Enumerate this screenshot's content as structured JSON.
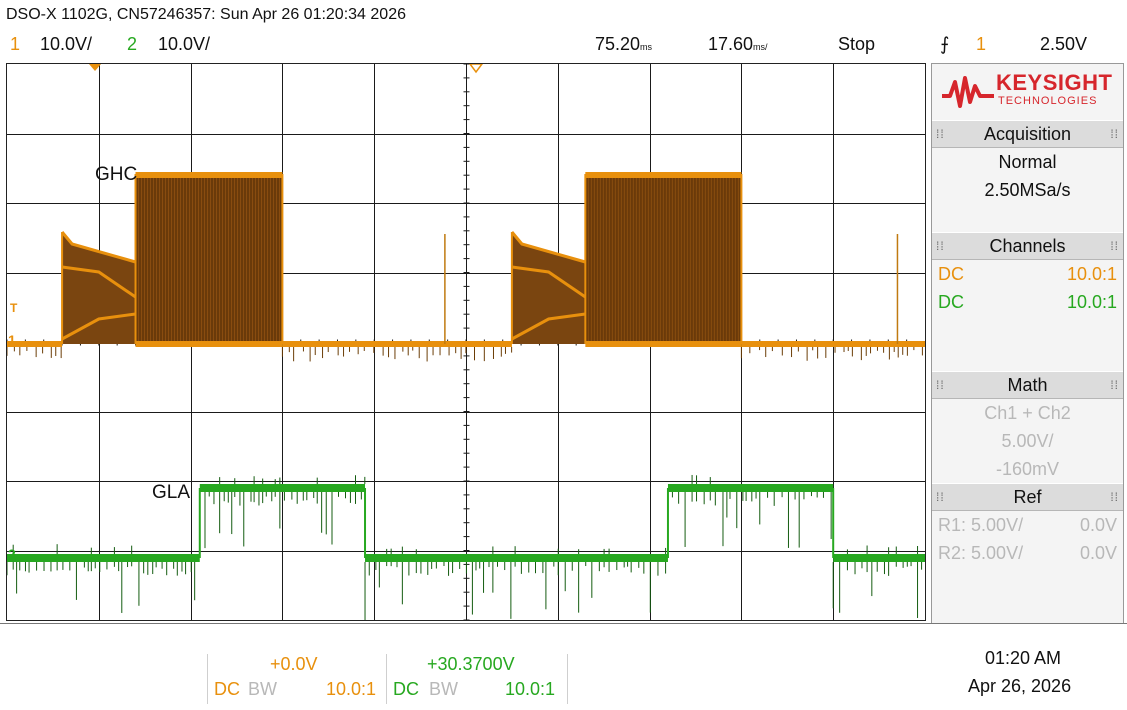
{
  "header": {
    "title": "DSO-X 1102G, CN57246357: Sun Apr 26 01:20:34 2026",
    "ch1_number": "1",
    "ch1_scale": "10.0V/",
    "ch2_number": "2",
    "ch2_scale": "10.0V/",
    "time_delay": "75.20",
    "time_delay_unit": "ms",
    "time_scale": "17.60",
    "time_scale_unit": "ms/",
    "run_state": "Stop",
    "trigger_edge": "⨍",
    "trigger_source": "1",
    "trigger_level": "2.50V"
  },
  "display": {
    "trace1_label": "GHC",
    "trace2_label": "GLA",
    "ch1_marker": "1",
    "ch2_marker": "2",
    "trigger_marker": "T"
  },
  "panel": {
    "brand_name": "KEYSIGHT",
    "brand_sub": "TECHNOLOGIES",
    "acquisition": {
      "title": "Acquisition",
      "mode": "Normal",
      "rate": "2.50MSa/s"
    },
    "channels": {
      "title": "Channels",
      "rows": [
        {
          "coupling": "DC",
          "probe": "10.0:1",
          "color": "#e8900d"
        },
        {
          "coupling": "DC",
          "probe": "10.0:1",
          "color": "#27a820"
        }
      ]
    },
    "math": {
      "title": "Math",
      "expr": "Ch1 + Ch2",
      "scale": "5.00V/",
      "offset": "-160mV"
    },
    "ref": {
      "title": "Ref",
      "rows": [
        {
          "name": "R1:",
          "scale": "5.00V/",
          "offset": "0.0V"
        },
        {
          "name": "R2:",
          "scale": "5.00V/",
          "offset": "0.0V"
        }
      ]
    }
  },
  "bottom": {
    "ch1": {
      "offset": "+0.0V",
      "coupling": "DC",
      "bw": "BW",
      "probe": "10.0:1"
    },
    "ch2": {
      "offset": "+30.3700V",
      "coupling": "DC",
      "bw": "BW",
      "probe": "10.0:1"
    },
    "time": "01:20 AM",
    "date": "Apr 26, 2026"
  },
  "colors": {
    "ch1": "#e8900d",
    "ch2": "#27a820",
    "grid": "#111111",
    "brand": "#d6262c"
  },
  "signals": {
    "ghc_segments": [
      {
        "from": 0.0,
        "to": 0.06,
        "state": "low"
      },
      {
        "from": 0.06,
        "to": 0.14,
        "state": "ramp"
      },
      {
        "from": 0.14,
        "to": 0.3,
        "state": "high"
      },
      {
        "from": 0.3,
        "to": 0.55,
        "state": "low"
      },
      {
        "from": 0.55,
        "to": 0.63,
        "state": "ramp"
      },
      {
        "from": 0.63,
        "to": 0.8,
        "state": "high"
      },
      {
        "from": 0.8,
        "to": 1.0,
        "state": "low"
      }
    ],
    "gla_segments": [
      {
        "from": 0.0,
        "to": 0.21,
        "state": "low"
      },
      {
        "from": 0.21,
        "to": 0.39,
        "state": "high"
      },
      {
        "from": 0.39,
        "to": 0.72,
        "state": "low"
      },
      {
        "from": 0.72,
        "to": 0.9,
        "state": "high"
      },
      {
        "from": 0.9,
        "to": 1.0,
        "state": "low"
      }
    ]
  }
}
